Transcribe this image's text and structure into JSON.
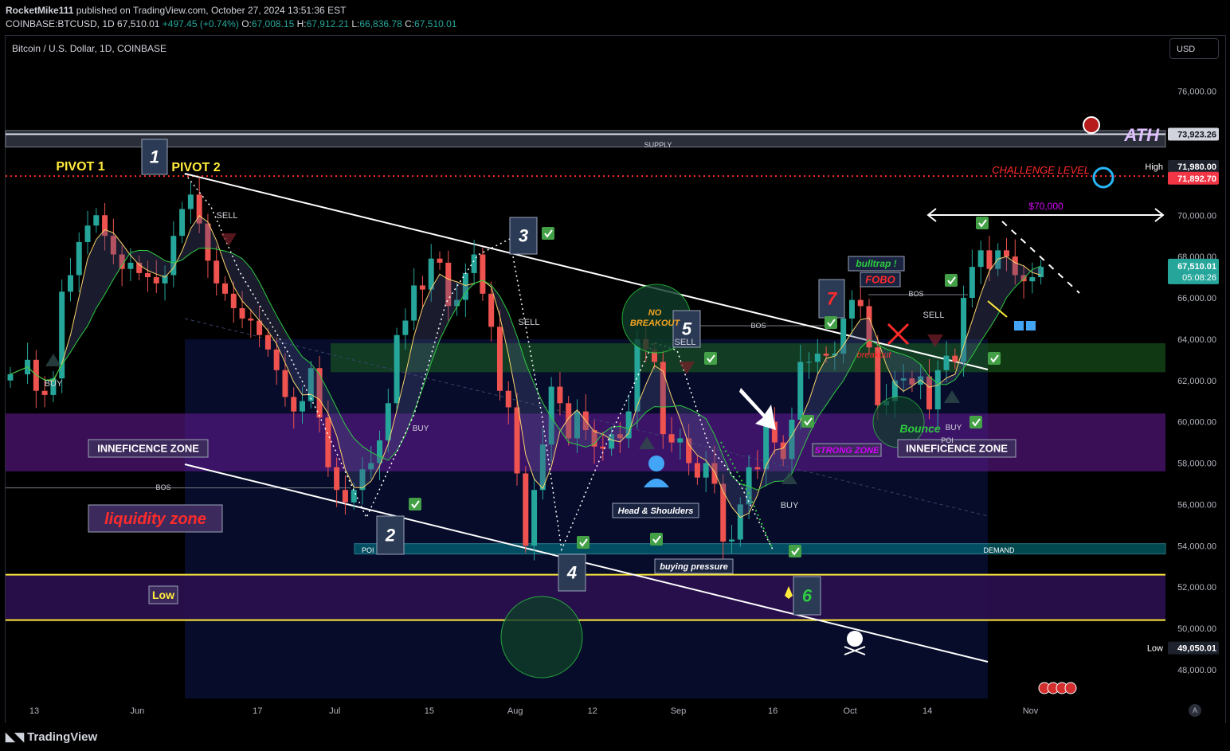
{
  "header": {
    "author": "RocketMike111",
    "published_text": "published on TradingView.com, October 27, 2024 13:51:36 EST",
    "symbol_line": "COINBASE:BTCUSD, 1D",
    "last": "67,510.01",
    "change": "+497.45 (+0.74%)",
    "open": "67,008.15",
    "high": "67,912.21",
    "low": "66,836.78",
    "close": "67,510.01",
    "labels": {
      "o": "O:",
      "h": "H:",
      "l": "L:",
      "c": "C:"
    }
  },
  "chart_title": "Bitcoin / U.S. Dollar, 1D, COINBASE",
  "currency_button": "USD",
  "footer": {
    "brand": "TradingView",
    "auto_label": "A"
  },
  "colors": {
    "background": "#000000",
    "up": "#26a69a",
    "down": "#ef5350",
    "price_tag": "#26a69a",
    "challenge_red": "#ff2b2b",
    "pivot_yellow": "#ffeb3b",
    "zone_purple": "#6a1b9a",
    "zone_green": "#1b5e20",
    "zone_teal": "#00838f",
    "zone_navy": "#0d1a5c"
  },
  "chart_data": {
    "type": "candlestick",
    "timeframe": "1D",
    "y_axis": {
      "ylim": [
        46800,
        77400
      ],
      "ticks": [
        48000,
        50000,
        52000,
        54000,
        56000,
        58000,
        60000,
        62000,
        64000,
        66000,
        68000,
        70000,
        72000,
        74000,
        76000
      ],
      "tick_labels": [
        "48,000.00",
        "50,000.00",
        "52,000.00",
        "54,000.00",
        "56,000.00",
        "58,000.00",
        "60,000.00",
        "62,000.00",
        "64,000.00",
        "66,000.00",
        "68,000.00",
        "70,000.00",
        "72,000.00",
        "74,000.00",
        "76,000.00"
      ]
    },
    "x_axis": {
      "tick_labels": [
        "13",
        "Jun",
        "17",
        "Jul",
        "15",
        "Aug",
        "12",
        "Sep",
        "16",
        "Oct",
        "14",
        "Nov"
      ],
      "tick_index": [
        0,
        12,
        26,
        35,
        46,
        56,
        65,
        75,
        86,
        95,
        104,
        116
      ]
    },
    "candle_close_anchors": [
      [
        0,
        62300
      ],
      [
        2,
        63000
      ],
      [
        3,
        61500
      ],
      [
        4,
        61300
      ],
      [
        5,
        62100
      ],
      [
        6,
        66300
      ],
      [
        7,
        67100
      ],
      [
        8,
        68700
      ],
      [
        9,
        69500
      ],
      [
        10,
        70000
      ],
      [
        11,
        69000
      ],
      [
        12,
        68100
      ],
      [
        13,
        67400
      ],
      [
        14,
        67700
      ],
      [
        15,
        67200
      ],
      [
        16,
        67000
      ],
      [
        17,
        66700
      ],
      [
        18,
        67100
      ],
      [
        19,
        69000
      ],
      [
        20,
        70300
      ],
      [
        21,
        71000
      ],
      [
        22,
        69600
      ],
      [
        23,
        67800
      ],
      [
        24,
        66700
      ],
      [
        25,
        66200
      ],
      [
        26,
        65500
      ],
      [
        27,
        65000
      ],
      [
        28,
        64900
      ],
      [
        29,
        64200
      ],
      [
        30,
        63500
      ],
      [
        31,
        62500
      ],
      [
        32,
        61200
      ],
      [
        33,
        60500
      ],
      [
        34,
        61000
      ],
      [
        35,
        62600
      ],
      [
        36,
        60200
      ],
      [
        37,
        57800
      ],
      [
        38,
        56700
      ],
      [
        39,
        56100
      ],
      [
        40,
        56700
      ],
      [
        41,
        57700
      ],
      [
        42,
        58000
      ],
      [
        43,
        59100
      ],
      [
        44,
        60900
      ],
      [
        45,
        64200
      ],
      [
        46,
        64900
      ],
      [
        47,
        66600
      ],
      [
        48,
        66400
      ],
      [
        49,
        67900
      ],
      [
        50,
        67700
      ],
      [
        51,
        65600
      ],
      [
        52,
        65900
      ],
      [
        53,
        67200
      ],
      [
        54,
        68100
      ],
      [
        55,
        66200
      ],
      [
        56,
        64600
      ],
      [
        57,
        61500
      ],
      [
        58,
        60700
      ],
      [
        59,
        57500
      ],
      [
        60,
        54000
      ],
      [
        61,
        56700
      ],
      [
        62,
        58900
      ],
      [
        63,
        61700
      ],
      [
        64,
        60900
      ],
      [
        65,
        59200
      ],
      [
        66,
        60500
      ],
      [
        67,
        59600
      ],
      [
        68,
        58800
      ],
      [
        69,
        58700
      ],
      [
        70,
        59400
      ],
      [
        71,
        59200
      ],
      [
        72,
        60500
      ],
      [
        73,
        64000
      ],
      [
        74,
        63500
      ],
      [
        75,
        62900
      ],
      [
        76,
        59400
      ],
      [
        77,
        59000
      ],
      [
        78,
        59200
      ],
      [
        79,
        58000
      ],
      [
        80,
        57300
      ],
      [
        81,
        58000
      ],
      [
        82,
        57000
      ],
      [
        83,
        54200
      ],
      [
        84,
        54300
      ],
      [
        85,
        56000
      ],
      [
        86,
        57800
      ],
      [
        87,
        57700
      ],
      [
        88,
        60000
      ],
      [
        89,
        59000
      ],
      [
        90,
        58200
      ],
      [
        91,
        60100
      ],
      [
        92,
        62900
      ],
      [
        93,
        62900
      ],
      [
        94,
        63300
      ],
      [
        95,
        63200
      ],
      [
        96,
        63300
      ],
      [
        97,
        65000
      ],
      [
        98,
        65900
      ],
      [
        99,
        65600
      ],
      [
        100,
        63600
      ],
      [
        101,
        60800
      ],
      [
        102,
        61000
      ],
      [
        103,
        62000
      ],
      [
        104,
        62100
      ],
      [
        105,
        61800
      ],
      [
        106,
        62200
      ],
      [
        107,
        60600
      ],
      [
        108,
        62500
      ],
      [
        109,
        63200
      ],
      [
        110,
        62900
      ],
      [
        111,
        66000
      ],
      [
        112,
        67500
      ],
      [
        113,
        68300
      ],
      [
        114,
        67400
      ],
      [
        115,
        68300
      ],
      [
        116,
        68000
      ],
      [
        117,
        67100
      ],
      [
        118,
        66800
      ],
      [
        119,
        67000
      ],
      [
        120,
        67500
      ]
    ],
    "horizontal_levels": {
      "ath": {
        "label": "ATH",
        "value": 73923.26,
        "value_label": "73,923.26"
      },
      "challenge_level": {
        "label": "CHALLENGE LEVEL",
        "value": 71892.7,
        "value_label": "71,892.70"
      },
      "high": {
        "label": "High",
        "value": 71980.0,
        "value_label": "71,980.00"
      },
      "low_marker": {
        "label": "Low",
        "value": 49050.01,
        "value_label": "49,050.01"
      },
      "last_price": {
        "value": 67510.01,
        "value_label": "67,510.01",
        "countdown": "05:08:26"
      },
      "yellow_line_1": 52600,
      "yellow_line_2": 50400,
      "bos_left": 56800
    },
    "zones": [
      {
        "name": "SUPPLY",
        "from": 73300,
        "to": 74100
      },
      {
        "name": "INNEFICENCE ZONE",
        "from": 57600,
        "to": 60400
      },
      {
        "name": "green zone",
        "from": 62400,
        "to": 63800
      },
      {
        "name": "DEMAND",
        "from": 53600,
        "to": 54100
      },
      {
        "name": "Low box",
        "from": 50400,
        "to": 52600
      }
    ],
    "annotations": {
      "pivot1": "PIVOT 1",
      "pivot2": "PIVOT 2",
      "n1": "1",
      "n2": "2",
      "n3": "3",
      "n4": "4",
      "n5": "5",
      "n6": "6",
      "n7": "7",
      "sell": "SELL",
      "buy": "BUY",
      "bos": "BOS",
      "poi": "POI",
      "supply": "SUPPLY",
      "demand": "DEMAND",
      "ineff_left": "INNEFICENCE ZONE",
      "ineff_right": "INNEFICENCE ZONE",
      "liquidity": "liquidity zone",
      "low_box": "Low",
      "no_breakout": "NO\nBREAKOUT",
      "head_shoulders": "Head & Shoulders",
      "buying_pressure": "buying pressure",
      "strong_zone": "STRONG ZONE",
      "bulltrap": "bulltrap !",
      "fobo": "FOBO",
      "breakout": "breakout",
      "bounce": "Bounce",
      "target": "$70,000"
    }
  }
}
